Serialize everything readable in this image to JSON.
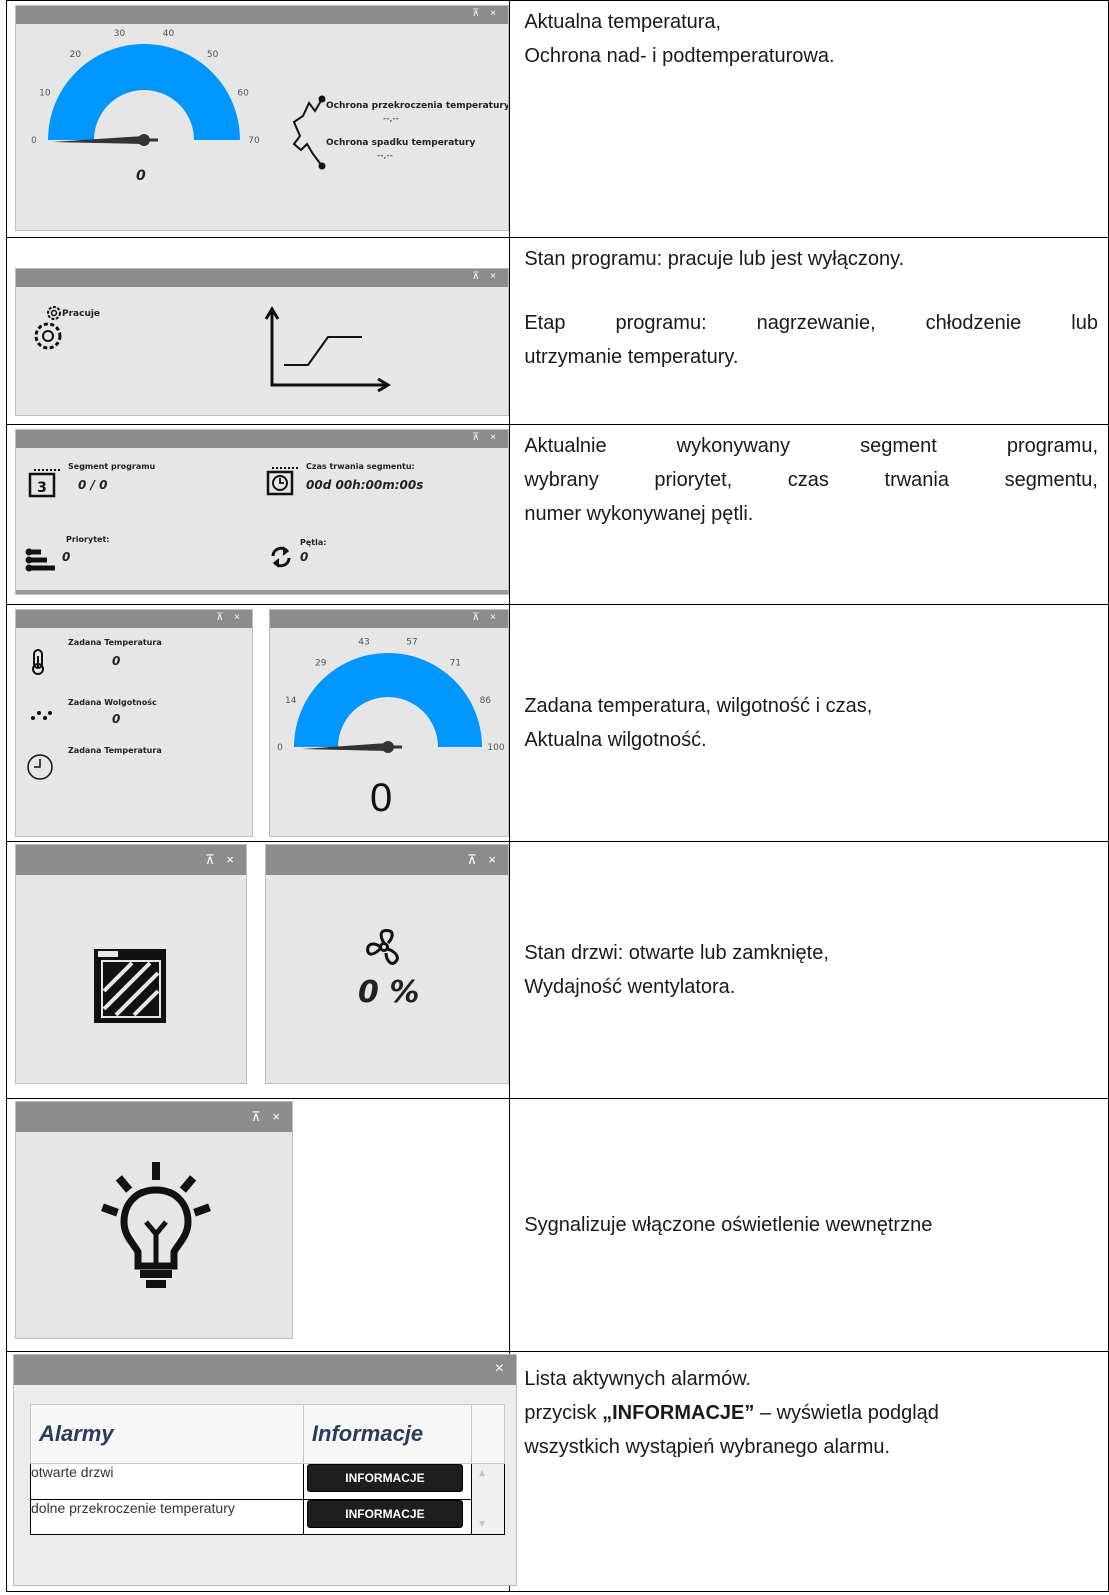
{
  "rows": [
    {
      "text_lines": [
        "Aktualna temperatura,",
        "Ochrona nad- i podtemperaturowa."
      ],
      "ui": {
        "gauge_ticks": [
          "0",
          "10",
          "20",
          "30",
          "40",
          "50",
          "60",
          "70"
        ],
        "gauge_value": "0",
        "protect_over_label": "Ochrona przekroczenia temperatury",
        "protect_over_value": "--,--",
        "protect_under_label": "Ochrona spadku temperatury",
        "protect_under_value": "--,--"
      }
    },
    {
      "text_lines": [
        "Stan programu: pracuje lub jest wyłączony.",
        "Etap programu: nagrzewanie, chłodzenie lub",
        "utrzymanie temperatury."
      ],
      "ui": {
        "status_label": "Pracuje"
      }
    },
    {
      "text_lines": [
        "Aktualnie wykonywany segment programu,",
        "wybrany priorytet, czas trwania segmentu,",
        "numer wykonywanej pętli."
      ],
      "ui": {
        "segment_label": "Segment programu",
        "segment_value": "0 / 0",
        "duration_label": "Czas trwania segmentu:",
        "duration_value": "00d 00h:00m:00s",
        "priority_label": "Priorytet:",
        "priority_value": "0",
        "loop_label": "Pętla:",
        "loop_value": "0",
        "calendar_digit": "3"
      }
    },
    {
      "text_lines": [
        "Zadana temperatura, wilgotność i czas,",
        "Aktualna wilgotność."
      ],
      "ui": {
        "set_temp_label": "Zadana Temperatura",
        "set_temp_value": "0",
        "set_hum_label": "Zadana Wolgotnośc",
        "set_hum_value": "0",
        "set_time_label": "Zadana Temperatura",
        "gauge_ticks": [
          "0",
          "14",
          "29",
          "43",
          "57",
          "71",
          "86",
          "100"
        ],
        "gauge_value": "0"
      }
    },
    {
      "text_lines": [
        "Stan drzwi: otwarte lub zamknięte,",
        "Wydajność wentylatora."
      ],
      "ui": {
        "fan_value": "0 %"
      }
    },
    {
      "text_lines": [
        "Sygnalizuje włączone oświetlenie wewnętrzne"
      ],
      "ui": {}
    },
    {
      "text_lines": [
        "Lista aktywnych alarmów."
      ],
      "text_bold_prefix": "przycisk ",
      "text_bold": "„INFORMACJE”",
      "text_bold_suffix": " – wyświetla podgląd",
      "text_last": "wszystkich wystąpień wybranego alarmu.",
      "ui": {
        "col_alarms": "Alarmy",
        "col_info": "Informacje",
        "alarms": [
          {
            "name": "otwarte drzwi",
            "button": "INFORMACJE"
          },
          {
            "name": "dolne przekroczenie temperatury",
            "button": "INFORMACJE"
          }
        ]
      }
    }
  ],
  "window_controls": "⊼ ×",
  "colors": {
    "gauge": "#0096ff",
    "titlebar": "#8c8c8c",
    "panel": "#e6e6e6",
    "button": "#1e1e1e"
  }
}
